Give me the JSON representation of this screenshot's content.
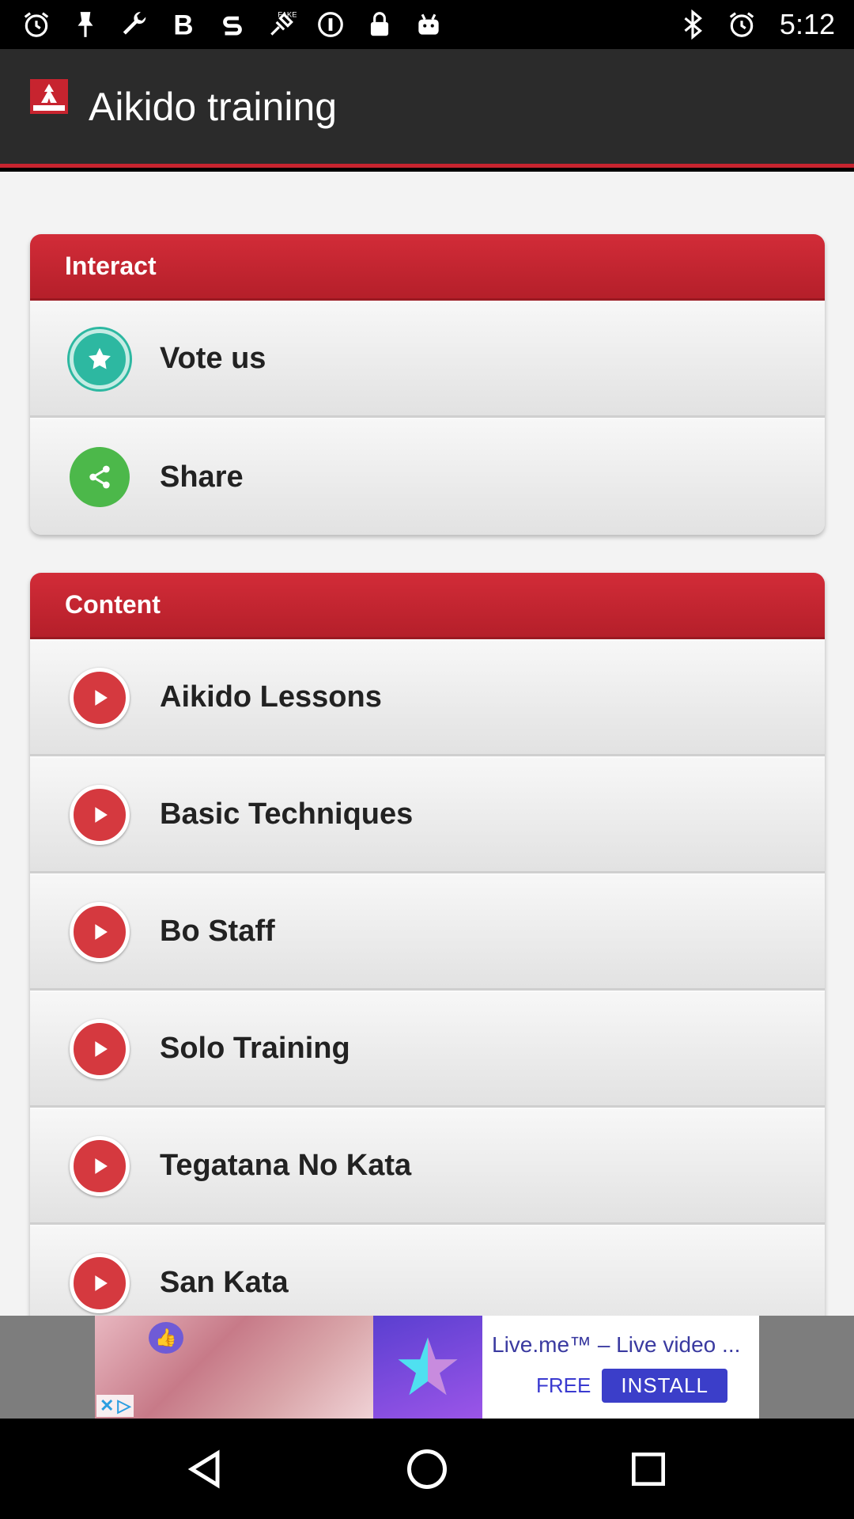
{
  "status_bar": {
    "time": "5:12",
    "left_icons": [
      "alarm-icon",
      "pin-icon",
      "wrench-icon",
      "bold-icon",
      "s-icon",
      "fake-gps-icon",
      "info-icon",
      "lock-icon",
      "android-icon"
    ],
    "right_icons": [
      "bluetooth-icon",
      "alarm-icon"
    ]
  },
  "app_bar": {
    "title": "Aikido training",
    "logo_text": "AIKIDO"
  },
  "sections": [
    {
      "header": "Interact",
      "items": [
        {
          "label": "Vote us",
          "icon": "star-icon"
        },
        {
          "label": "Share",
          "icon": "share-icon"
        }
      ]
    },
    {
      "header": "Content",
      "items": [
        {
          "label": "Aikido Lessons",
          "icon": "play-icon"
        },
        {
          "label": "Basic Techniques",
          "icon": "play-icon"
        },
        {
          "label": "Bo Staff",
          "icon": "play-icon"
        },
        {
          "label": "Solo Training",
          "icon": "play-icon"
        },
        {
          "label": "Tegatana No Kata",
          "icon": "play-icon"
        },
        {
          "label": "San Kata",
          "icon": "play-icon"
        }
      ]
    }
  ],
  "ad": {
    "title": "Live.me™ – Live video ...",
    "free_label": "FREE",
    "install_label": "INSTALL"
  },
  "colors": {
    "app_bar": "#2b2b2b",
    "accent_red": "#c7242f",
    "star_teal": "#2db8a1",
    "share_green": "#4cb84a",
    "play_red": "#d5393f"
  }
}
